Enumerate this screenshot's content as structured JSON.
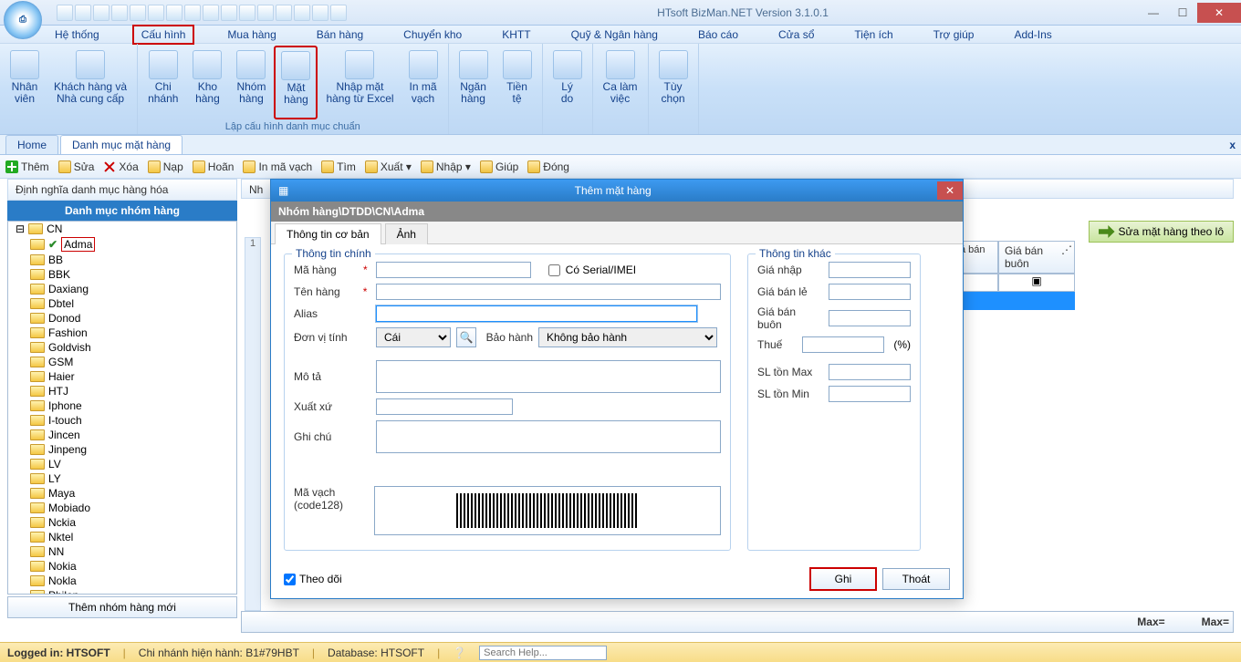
{
  "app": {
    "title": "HTsoft BizMan.NET Version 3.1.0.1",
    "orb": "⎙"
  },
  "menu": [
    "Hệ thống",
    "Cấu hình",
    "Mua hàng",
    "Bán hàng",
    "Chuyển kho",
    "KHTT",
    "Quỹ & Ngân hàng",
    "Báo cáo",
    "Cửa sổ",
    "Tiện ích",
    "Trợ giúp",
    "Add-Ins"
  ],
  "menu_highlight_index": 1,
  "ribbon": {
    "groups": [
      {
        "caption": "",
        "buttons": [
          {
            "l1": "Nhân",
            "l2": "viên"
          },
          {
            "l1": "Khách hàng và",
            "l2": "Nhà cung cấp"
          }
        ]
      },
      {
        "caption": "Lập cấu hình danh mục chuẩn",
        "buttons": [
          {
            "l1": "Chi",
            "l2": "nhánh"
          },
          {
            "l1": "Kho",
            "l2": "hàng"
          },
          {
            "l1": "Nhóm",
            "l2": "hàng"
          },
          {
            "l1": "Mặt",
            "l2": "hàng",
            "hl": true
          },
          {
            "l1": "Nhập mặt",
            "l2": "hàng từ Excel"
          },
          {
            "l1": "In mã",
            "l2": "vạch"
          }
        ]
      },
      {
        "caption": "",
        "buttons": [
          {
            "l1": "Ngăn",
            "l2": "hàng"
          },
          {
            "l1": "Tiền",
            "l2": "tệ"
          }
        ]
      },
      {
        "caption": "",
        "buttons": [
          {
            "l1": "Lý",
            "l2": "do"
          }
        ]
      },
      {
        "caption": "",
        "buttons": [
          {
            "l1": "Ca làm",
            "l2": "việc"
          }
        ]
      },
      {
        "caption": "",
        "buttons": [
          {
            "l1": "Tùy",
            "l2": "chọn"
          }
        ]
      }
    ]
  },
  "doc_tabs": [
    "Home",
    "Danh mục mặt hàng"
  ],
  "toolbar": [
    {
      "icon": "plus",
      "label": "Thêm"
    },
    {
      "icon": "pencil",
      "label": "Sửa"
    },
    {
      "icon": "x",
      "label": "Xóa"
    },
    {
      "icon": "refresh",
      "label": "Nạp"
    },
    {
      "icon": "undo",
      "label": "Hoãn"
    },
    {
      "icon": "print",
      "label": "In mã vạch"
    },
    {
      "icon": "search",
      "label": "Tìm"
    },
    {
      "icon": "export",
      "label": "Xuất ▾"
    },
    {
      "icon": "import",
      "label": "Nhập ▾"
    },
    {
      "icon": "help",
      "label": "Giúp"
    },
    {
      "icon": "close",
      "label": "Đóng"
    }
  ],
  "left": {
    "panel_title": "Định nghĩa danh mục hàng hóa",
    "group_header": "Danh mục nhóm hàng",
    "root": "CN",
    "items": [
      "Adma",
      "BB",
      "BBK",
      "Daxiang",
      "Dbtel",
      "Donod",
      "Fashion",
      "Goldvish",
      "GSM",
      "Haier",
      "HTJ",
      "Iphone",
      "I-touch",
      "Jincen",
      "Jinpeng",
      "LV",
      "LY",
      "Maya",
      "Mobiado",
      "Nckia",
      "Nktel",
      "NN",
      "Nokia",
      "Nokla",
      "Philon"
    ],
    "selected_index": 0,
    "new_group": "Thêm nhóm hàng mới"
  },
  "right": {
    "side_btn": "Sửa mặt hàng theo lô",
    "cols": [
      "Giá bán lẻ",
      "Giá bán buôn"
    ],
    "footer": [
      "Max=",
      "Max="
    ]
  },
  "dialog": {
    "title": "Thêm mặt hàng",
    "breadcrumb": "Nhóm hàng\\DTDD\\CN\\Adma",
    "tabs": [
      "Thông tin cơ bản",
      "Ảnh"
    ],
    "fs_main": "Thông tin chính",
    "fs_other": "Thông tin khác",
    "labels": {
      "ma": "Mã hàng",
      "ten": "Tên hàng",
      "alias": "Alias",
      "dvt": "Đơn vị tính",
      "bh": "Bảo hành",
      "mota": "Mô tả",
      "xuatxu": "Xuất xứ",
      "ghichu": "Ghi chú",
      "mavach": "Mã vạch",
      "mavach2": "(code128)",
      "serial": "Có Serial/IMEI",
      "gianhap": "Giá nhập",
      "giabanle": "Giá bán lẻ",
      "giabanbuon": "Giá bán buôn",
      "thue": "Thuế",
      "pct": "(%)",
      "slmax": "SL tồn Max",
      "slmin": "SL tồn Min"
    },
    "dvt_value": "Cái",
    "bh_value": "Không bảo hành",
    "track": "Theo dõi",
    "btn_save": "Ghi",
    "btn_exit": "Thoát"
  },
  "status": {
    "logged": "Logged in: HTSOFT",
    "branch": "Chi nhánh hiện hành: B1#79HBT",
    "db": "Database: HTSOFT",
    "search_ph": "Search Help..."
  },
  "right_panel_prefix": "Nh"
}
